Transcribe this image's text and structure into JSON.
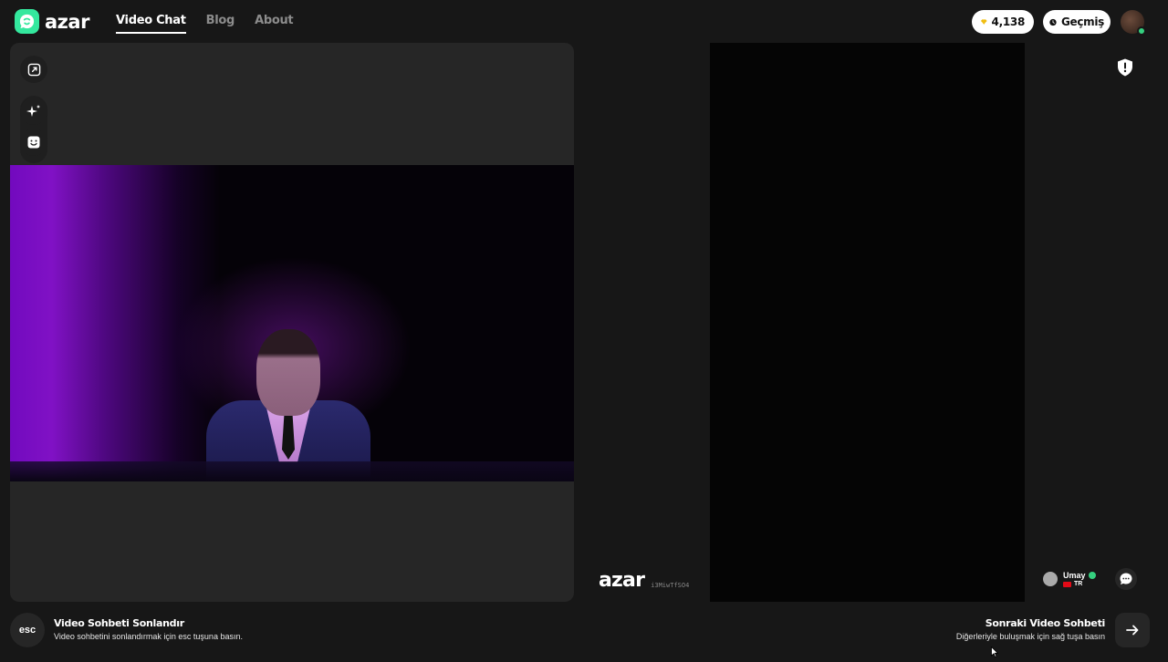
{
  "brand": {
    "name": "azar"
  },
  "nav": {
    "items": [
      {
        "label": "Video Chat",
        "active": true
      },
      {
        "label": "Blog",
        "active": false
      },
      {
        "label": "About",
        "active": false
      }
    ]
  },
  "header": {
    "gems": {
      "icon": "gem-icon",
      "count": "4,138"
    },
    "history": {
      "icon": "clock-icon",
      "label": "Geçmiş"
    },
    "avatar_badge": "1"
  },
  "tools": [
    {
      "icon": "expand-icon"
    },
    {
      "icon": "sparkle-effects-icon"
    },
    {
      "icon": "sticker-face-icon"
    }
  ],
  "remote": {
    "watermark": "azar",
    "id": "i3MiwTfSO4",
    "partner": {
      "name": "Umay",
      "country": "TR",
      "verified": true
    },
    "report_icon": "shield-alert-icon",
    "chat_icon": "chat-bubble-icon"
  },
  "footer": {
    "esc_key": "esc",
    "end_title": "Video Sohbeti Sonlandır",
    "end_subtitle": "Video sohbetini sonlandırmak için esc tuşuna basın.",
    "next_title": "Sonraki Video Sohbeti",
    "next_subtitle": "Diğerleriyle buluşmak için sağ tuşa basın",
    "next_icon": "arrow-right-icon"
  },
  "colors": {
    "accent": "#34e89e",
    "background": "#171717",
    "panel": "#262626",
    "verified": "#35d07f",
    "gem": "#f5c518"
  }
}
